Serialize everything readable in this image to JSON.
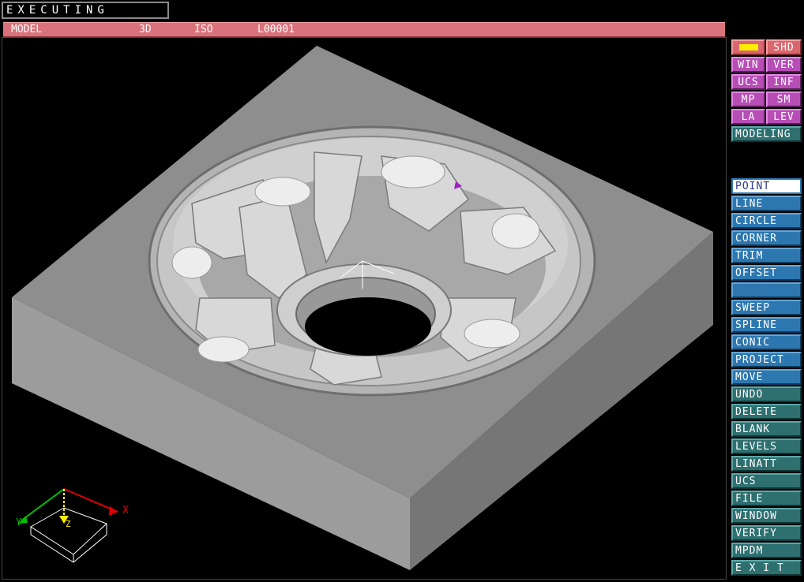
{
  "status": {
    "text": "EXECUTING"
  },
  "titlebar": {
    "mode": "MODEL",
    "dim": "3D",
    "view": "ISO",
    "level": "L00001"
  },
  "axes": {
    "x": "X",
    "y": "Y",
    "z": "Z"
  },
  "top_buttons": [
    {
      "left": "",
      "right": "SHD"
    },
    {
      "left": "WIN",
      "right": "VER"
    },
    {
      "left": "UCS",
      "right": "INF"
    },
    {
      "left": "MP",
      "right": "SM"
    },
    {
      "left": "LA",
      "right": "LEV"
    }
  ],
  "modeling": "MODELING",
  "menu_create": [
    "POINT",
    "LINE",
    "CIRCLE",
    "CORNER",
    "TRIM",
    "OFFSET",
    "",
    "SWEEP",
    "SPLINE",
    "CONIC",
    "PROJECT",
    "MOVE"
  ],
  "menu_util": [
    "UNDO",
    "DELETE",
    "BLANK",
    "LEVELS",
    "LINATT",
    "UCS",
    "FILE",
    "WINDOW",
    "VERIFY",
    "MPDM",
    "E X I T"
  ],
  "colors": {
    "title": "#d9727a",
    "block_top": "#8e8e8e",
    "block_left": "#9a9a9a",
    "block_right": "#777777",
    "selection": "#ffee00"
  }
}
